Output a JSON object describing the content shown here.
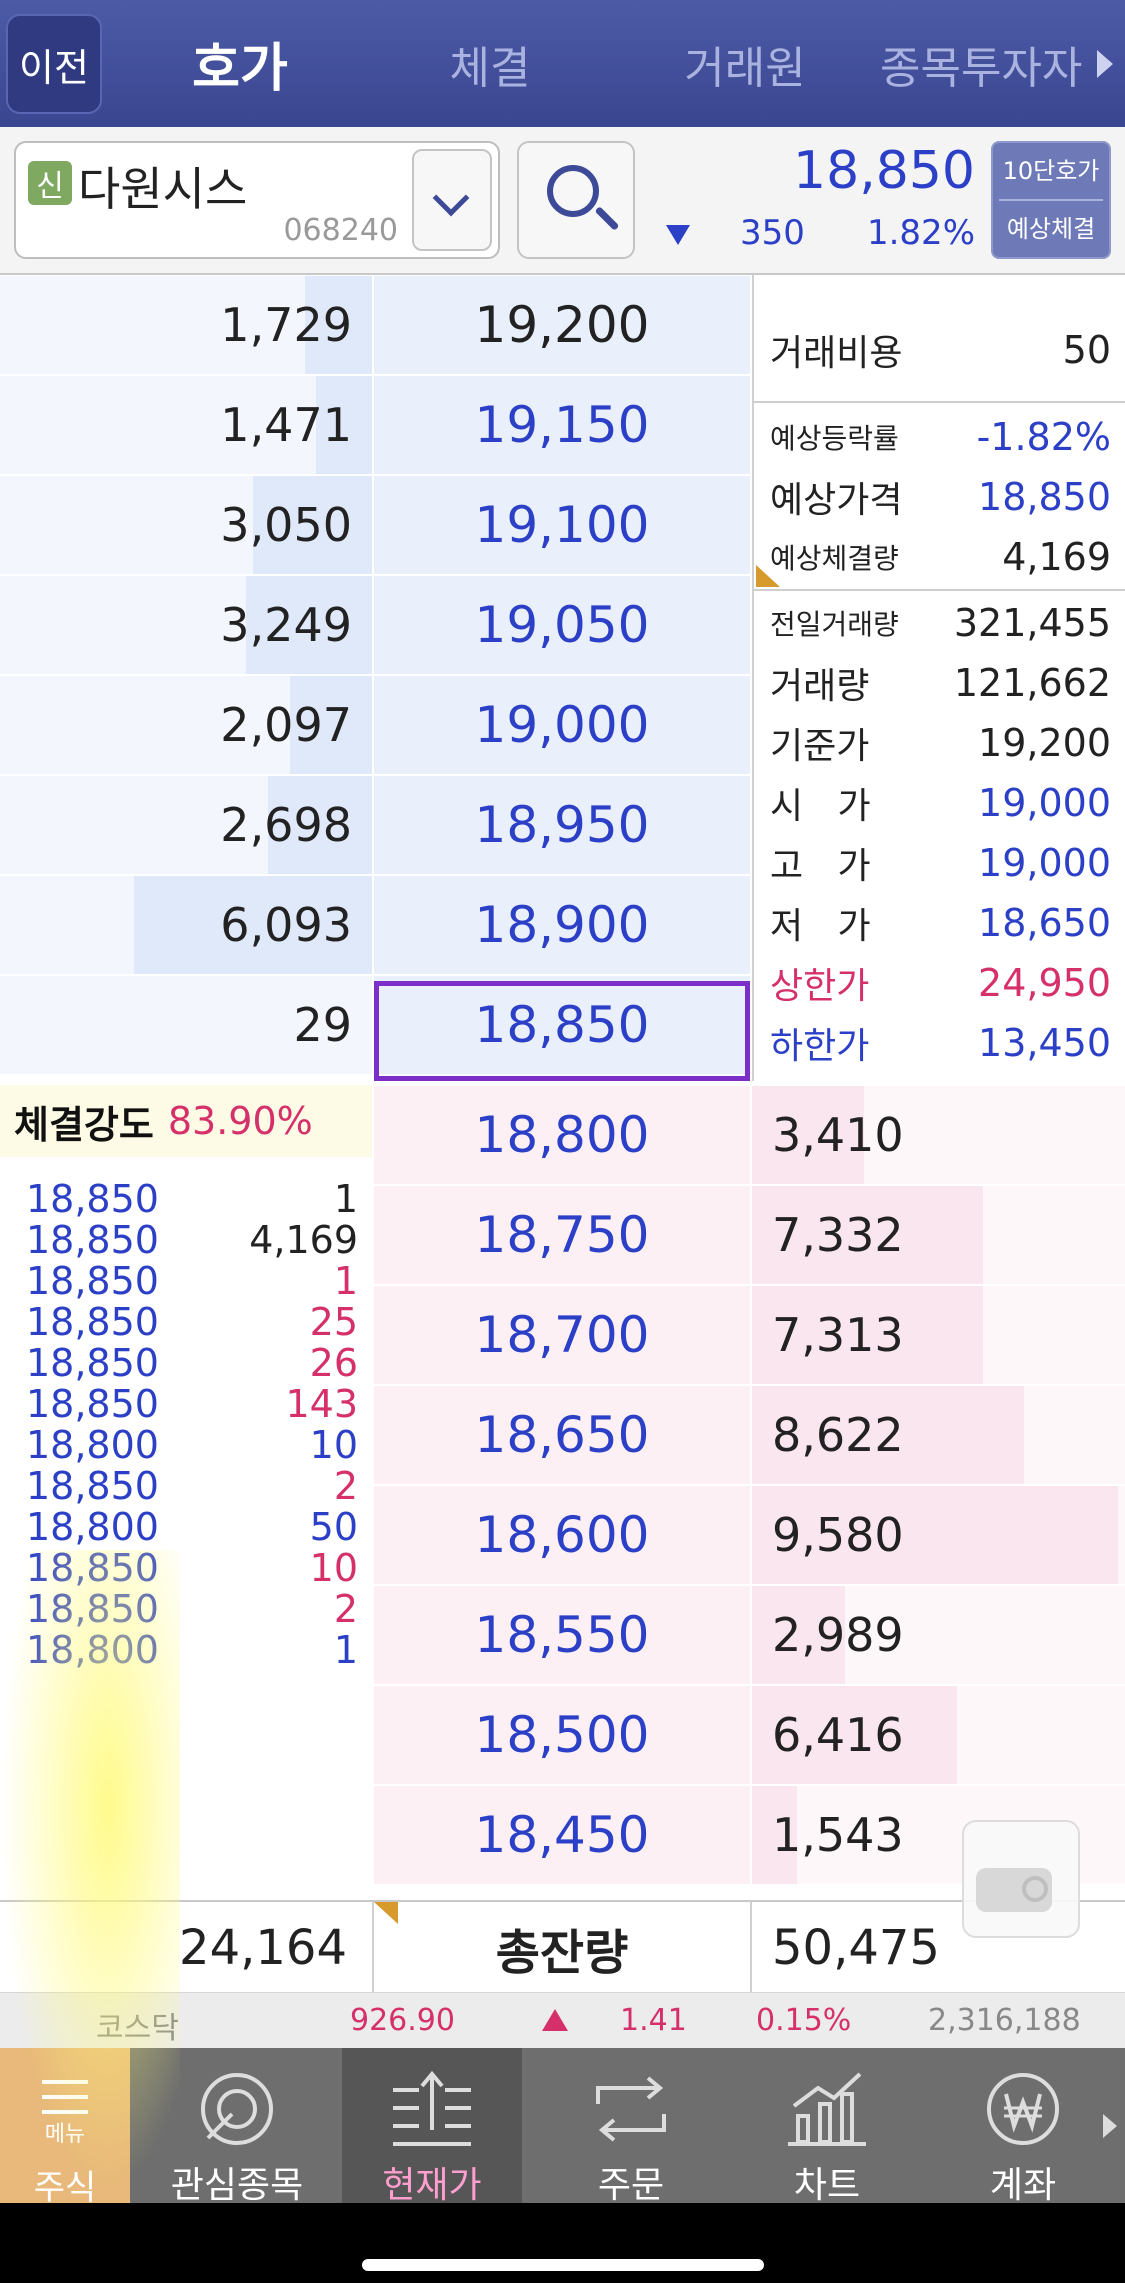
{
  "top_tabs": {
    "back_label": "이전",
    "tabs": [
      "호가",
      "체결",
      "거래원",
      "종목투자자"
    ],
    "active": "호가"
  },
  "stock": {
    "credit_badge": "신",
    "name": "다원시스",
    "code": "068240",
    "price": "18,850",
    "change": "350",
    "change_pct": "1.82%",
    "direction_icon": "down-triangle-icon",
    "mode_line1": "10단호가",
    "mode_line2": "예상체결"
  },
  "asks": [
    {
      "qty": "1,729",
      "price": "19,200",
      "level": 0.18
    },
    {
      "qty": "1,471",
      "price": "19,150",
      "level": 0.15
    },
    {
      "qty": "3,050",
      "price": "19,100",
      "level": 0.32
    },
    {
      "qty": "3,249",
      "price": "19,050",
      "level": 0.34
    },
    {
      "qty": "2,097",
      "price": "19,000",
      "level": 0.22
    },
    {
      "qty": "2,698",
      "price": "18,950",
      "level": 0.28
    },
    {
      "qty": "6,093",
      "price": "18,900",
      "level": 0.64
    },
    {
      "qty": "29",
      "price": "18,850",
      "level": 0.0
    }
  ],
  "bids": [
    {
      "price": "18,800",
      "qty": "3,410",
      "level": 0.3
    },
    {
      "price": "18,750",
      "qty": "7,332",
      "level": 0.62
    },
    {
      "price": "18,700",
      "qty": "7,313",
      "level": 0.62
    },
    {
      "price": "18,650",
      "qty": "8,622",
      "level": 0.73
    },
    {
      "price": "18,600",
      "qty": "9,580",
      "level": 0.98
    },
    {
      "price": "18,550",
      "qty": "2,989",
      "level": 0.25
    },
    {
      "price": "18,500",
      "qty": "6,416",
      "level": 0.55
    },
    {
      "price": "18,450",
      "qty": "1,543",
      "level": 0.12
    }
  ],
  "info": {
    "fee_label": "거래비용",
    "fee": "50",
    "exp_rate_label": "예상등락률",
    "exp_rate": "-1.82%",
    "exp_price_label": "예상가격",
    "exp_price": "18,850",
    "exp_vol_label": "예상체결량",
    "exp_vol": "4,169",
    "prev_vol_label": "전일거래량",
    "prev_vol": "321,455",
    "vol_label": "거래량",
    "vol": "121,662",
    "base_label": "기준가",
    "base": "19,200",
    "open_label": "시   가",
    "open": "19,000",
    "high_label": "고   가",
    "high": "19,000",
    "low_label": "저   가",
    "low": "18,650",
    "upper_label": "상한가",
    "upper": "24,950",
    "lower_label": "하한가",
    "lower": "13,450"
  },
  "strength": {
    "label": "체결강도",
    "value": "83.90%"
  },
  "trades": [
    {
      "price": "18,850",
      "qty": "1",
      "color": "#222222"
    },
    {
      "price": "18,850",
      "qty": "4,169",
      "color": "#222222"
    },
    {
      "price": "18,850",
      "qty": "1",
      "color": "#d5306a"
    },
    {
      "price": "18,850",
      "qty": "25",
      "color": "#d5306a"
    },
    {
      "price": "18,850",
      "qty": "26",
      "color": "#d5306a"
    },
    {
      "price": "18,850",
      "qty": "143",
      "color": "#d5306a"
    },
    {
      "price": "18,800",
      "qty": "10",
      "color": "#2b3fc7"
    },
    {
      "price": "18,850",
      "qty": "2",
      "color": "#d5306a"
    },
    {
      "price": "18,800",
      "qty": "50",
      "color": "#2b3fc7"
    },
    {
      "price": "18,850",
      "qty": "10",
      "color": "#d5306a"
    },
    {
      "price": "18,850",
      "qty": "2",
      "color": "#d5306a"
    },
    {
      "price": "18,800",
      "qty": "1",
      "color": "#2b3fc7"
    }
  ],
  "totals": {
    "ask_total": "24,164",
    "label": "총잔량",
    "bid_total": "50,475"
  },
  "index": {
    "name": "코스닥",
    "value": "926.90",
    "change": "1.41",
    "pct": "0.15%",
    "volume": "2,316,188"
  },
  "nav": {
    "menu_sub": "메뉴",
    "menu_label": "주식",
    "items": [
      {
        "label": "관심종목",
        "icon": "watchlist-icon"
      },
      {
        "label": "현재가",
        "icon": "current-price-icon"
      },
      {
        "label": "주문",
        "icon": "order-icon"
      },
      {
        "label": "차트",
        "icon": "chart-icon"
      },
      {
        "label": "계좌",
        "icon": "account-won-icon"
      }
    ],
    "active": "현재가"
  },
  "colors": {
    "up": "#d5306a",
    "down": "#2b3fc7",
    "header": "#3d4a97",
    "highlight_frame": "#7b2fc8"
  }
}
